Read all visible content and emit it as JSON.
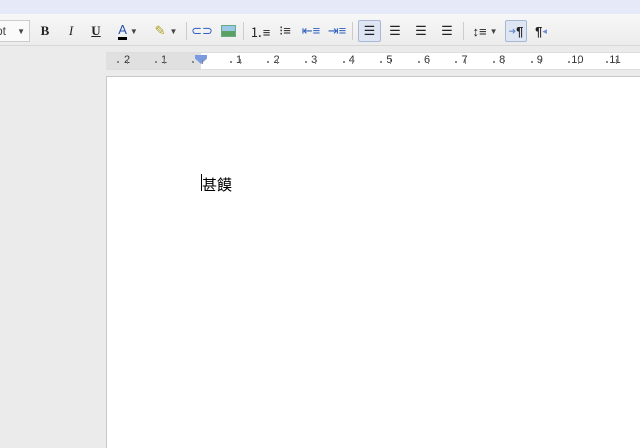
{
  "toolbar": {
    "font_size": "pt",
    "bold": "B",
    "italic": "I",
    "underline": "U",
    "text_color": "A",
    "paragraph_ltr": "¶",
    "paragraph_rtl": "¶"
  },
  "ruler": {
    "left_labels": [
      "2",
      "1"
    ],
    "right_labels": [
      "1",
      "2",
      "3",
      "4",
      "5",
      "6",
      "7",
      "8",
      "9",
      "10",
      "11"
    ]
  },
  "document": {
    "text": "甚饃"
  },
  "colors": {
    "accent": "#7a9be0",
    "active_bg": "#dfe6f3"
  }
}
